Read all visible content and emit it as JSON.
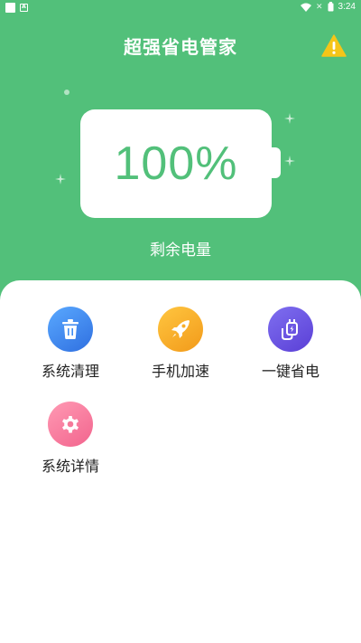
{
  "status_bar": {
    "time": "3:24",
    "sim_label": "✕",
    "icons": [
      "notification-square-icon",
      "app-a-icon",
      "wifi-icon",
      "no-sim-icon",
      "battery-icon"
    ]
  },
  "header": {
    "title": "超强省电管家",
    "warning_icon": "warning-icon"
  },
  "battery": {
    "level_text": "100%",
    "label": "剩余电量"
  },
  "tools": [
    {
      "label": "系统清理",
      "icon": "trash-icon",
      "color": "#3f8cf2"
    },
    {
      "label": "手机加速",
      "icon": "rocket-icon",
      "color": "#f7ae2a"
    },
    {
      "label": "一键省电",
      "icon": "charging-plug-icon",
      "color": "#6a55e3"
    },
    {
      "label": "系统详情",
      "icon": "gear-icon",
      "color": "#f57a9a"
    }
  ],
  "colors": {
    "primary_green": "#52c07a",
    "warning_yellow": "#f5c518"
  }
}
